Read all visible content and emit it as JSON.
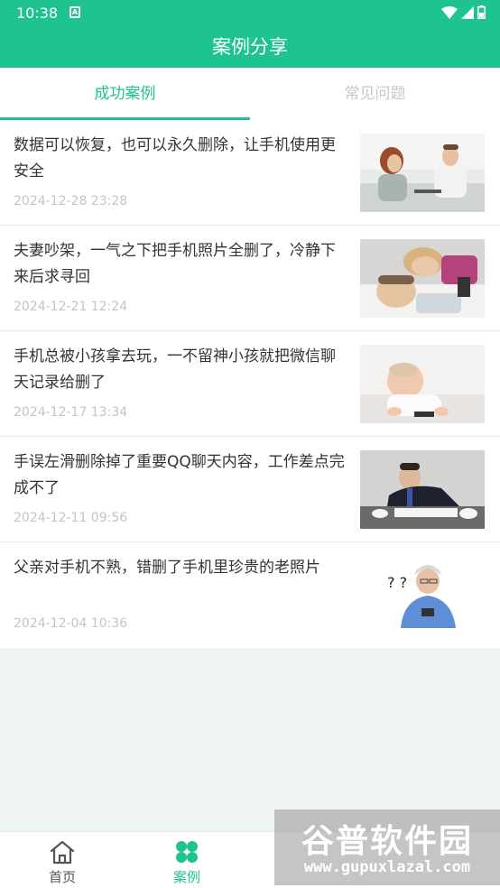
{
  "status_bar": {
    "time": "10:38",
    "notification_glyph": "A"
  },
  "header": {
    "title": "案例分享"
  },
  "tabs": [
    {
      "label": "成功案例",
      "active": true
    },
    {
      "label": "常见问题",
      "active": false
    }
  ],
  "cases": [
    {
      "title": "数据可以恢复，也可以永久删除，让手机使用更安全",
      "date": "2024-12-28 23:28",
      "image": "couple-at-table"
    },
    {
      "title": "夫妻吵架，一气之下把手机照片全删了，冷静下来后求寻回",
      "date": "2024-12-21 12:24",
      "image": "couple-lying-down"
    },
    {
      "title": "手机总被小孩拿去玩，一不留神小孩就把微信聊天记录给删了",
      "date": "2024-12-17 13:34",
      "image": "baby-with-phone"
    },
    {
      "title": "手误左滑删除掉了重要QQ聊天内容，工作差点完成不了",
      "date": "2024-12-11 09:56",
      "image": "stressed-businessman"
    },
    {
      "title": "父亲对手机不熟，错删了手机里珍贵的老照片",
      "date": "2024-12-04 10:36",
      "image": "confused-old-man"
    }
  ],
  "bottom_nav": [
    {
      "label": "首页",
      "icon": "home-icon",
      "active": false
    },
    {
      "label": "案例",
      "icon": "grid-icon",
      "active": true
    }
  ],
  "watermark": {
    "main": "谷普软件园",
    "sub": "www.gupuxlazal.com"
  },
  "colors": {
    "accent": "#1ec38f",
    "inactive": "#c8c8c8",
    "text": "#333333",
    "date": "#c4c4c4",
    "background": "#eef4f2"
  }
}
